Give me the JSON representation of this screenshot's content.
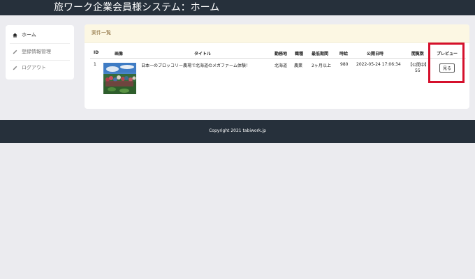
{
  "header": {
    "title": "旅ワーク企業会員様システム：ホーム"
  },
  "sidebar": {
    "items": [
      {
        "label": "ホーム",
        "icon": "home-icon",
        "active": true
      },
      {
        "label": "登録情報管理",
        "icon": "pencil-icon",
        "active": false
      },
      {
        "label": "ログアウト",
        "icon": "pencil-icon",
        "active": false
      }
    ]
  },
  "main": {
    "card_title": "案件一覧",
    "columns": [
      "ID",
      "画像",
      "タイトル",
      "勤務地",
      "職種",
      "最低期間",
      "時給",
      "公開日時",
      "閲覧数",
      "プレビュー"
    ],
    "rows": [
      {
        "id": "1",
        "title": "日本一のブロッコリー農場で北海道のメガファーム体験！",
        "location": "北海道",
        "job": "農業",
        "period": "2ヶ月以上",
        "wage": "980",
        "published": "2022-05-24 17:06:34",
        "status": "【公開中】",
        "views": "55",
        "preview_label": "見る"
      }
    ]
  },
  "footer": {
    "copyright": "Copyright 2021 tabiwork.jp"
  },
  "colors": {
    "header_bg": "#26303b",
    "card_head_bg": "#fcf7e3",
    "card_title": "#8a6d3b",
    "highlight": "#d5102c"
  }
}
